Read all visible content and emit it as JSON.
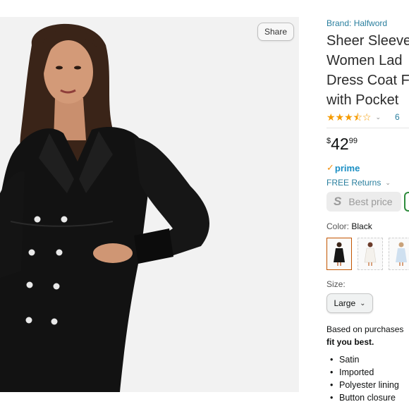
{
  "toolbar": {
    "share_label": "Share"
  },
  "product": {
    "brand": "Brand: Halfword",
    "title_lines": [
      "Sheer Sleeve",
      "Women Lad",
      "Dress Coat F",
      "with Pocket"
    ],
    "rating_value": 3.5,
    "rating_count": "6",
    "price": {
      "symbol": "$",
      "whole": "42",
      "fraction": "99"
    },
    "prime_label": "prime",
    "returns_label": "FREE Returns",
    "best_price": {
      "logo": "S",
      "label": "Best price"
    },
    "color": {
      "label": "Color:",
      "value": "Black"
    },
    "swatches": [
      "black-dress",
      "white-dress",
      "light-blue-dress"
    ],
    "size": {
      "label": "Size:",
      "selected": "Large"
    },
    "fit": {
      "prefix": "Based on purchases",
      "bold": "fit you best."
    },
    "features": [
      "Satin",
      "Imported",
      "Polyester lining",
      "Button closure"
    ]
  },
  "colors": {
    "link": "#2a7f9e",
    "star": "#f59b00",
    "prime": "#1b8fc4",
    "selected_swatch": "#c45500",
    "green_outline": "#2e8b3c"
  }
}
